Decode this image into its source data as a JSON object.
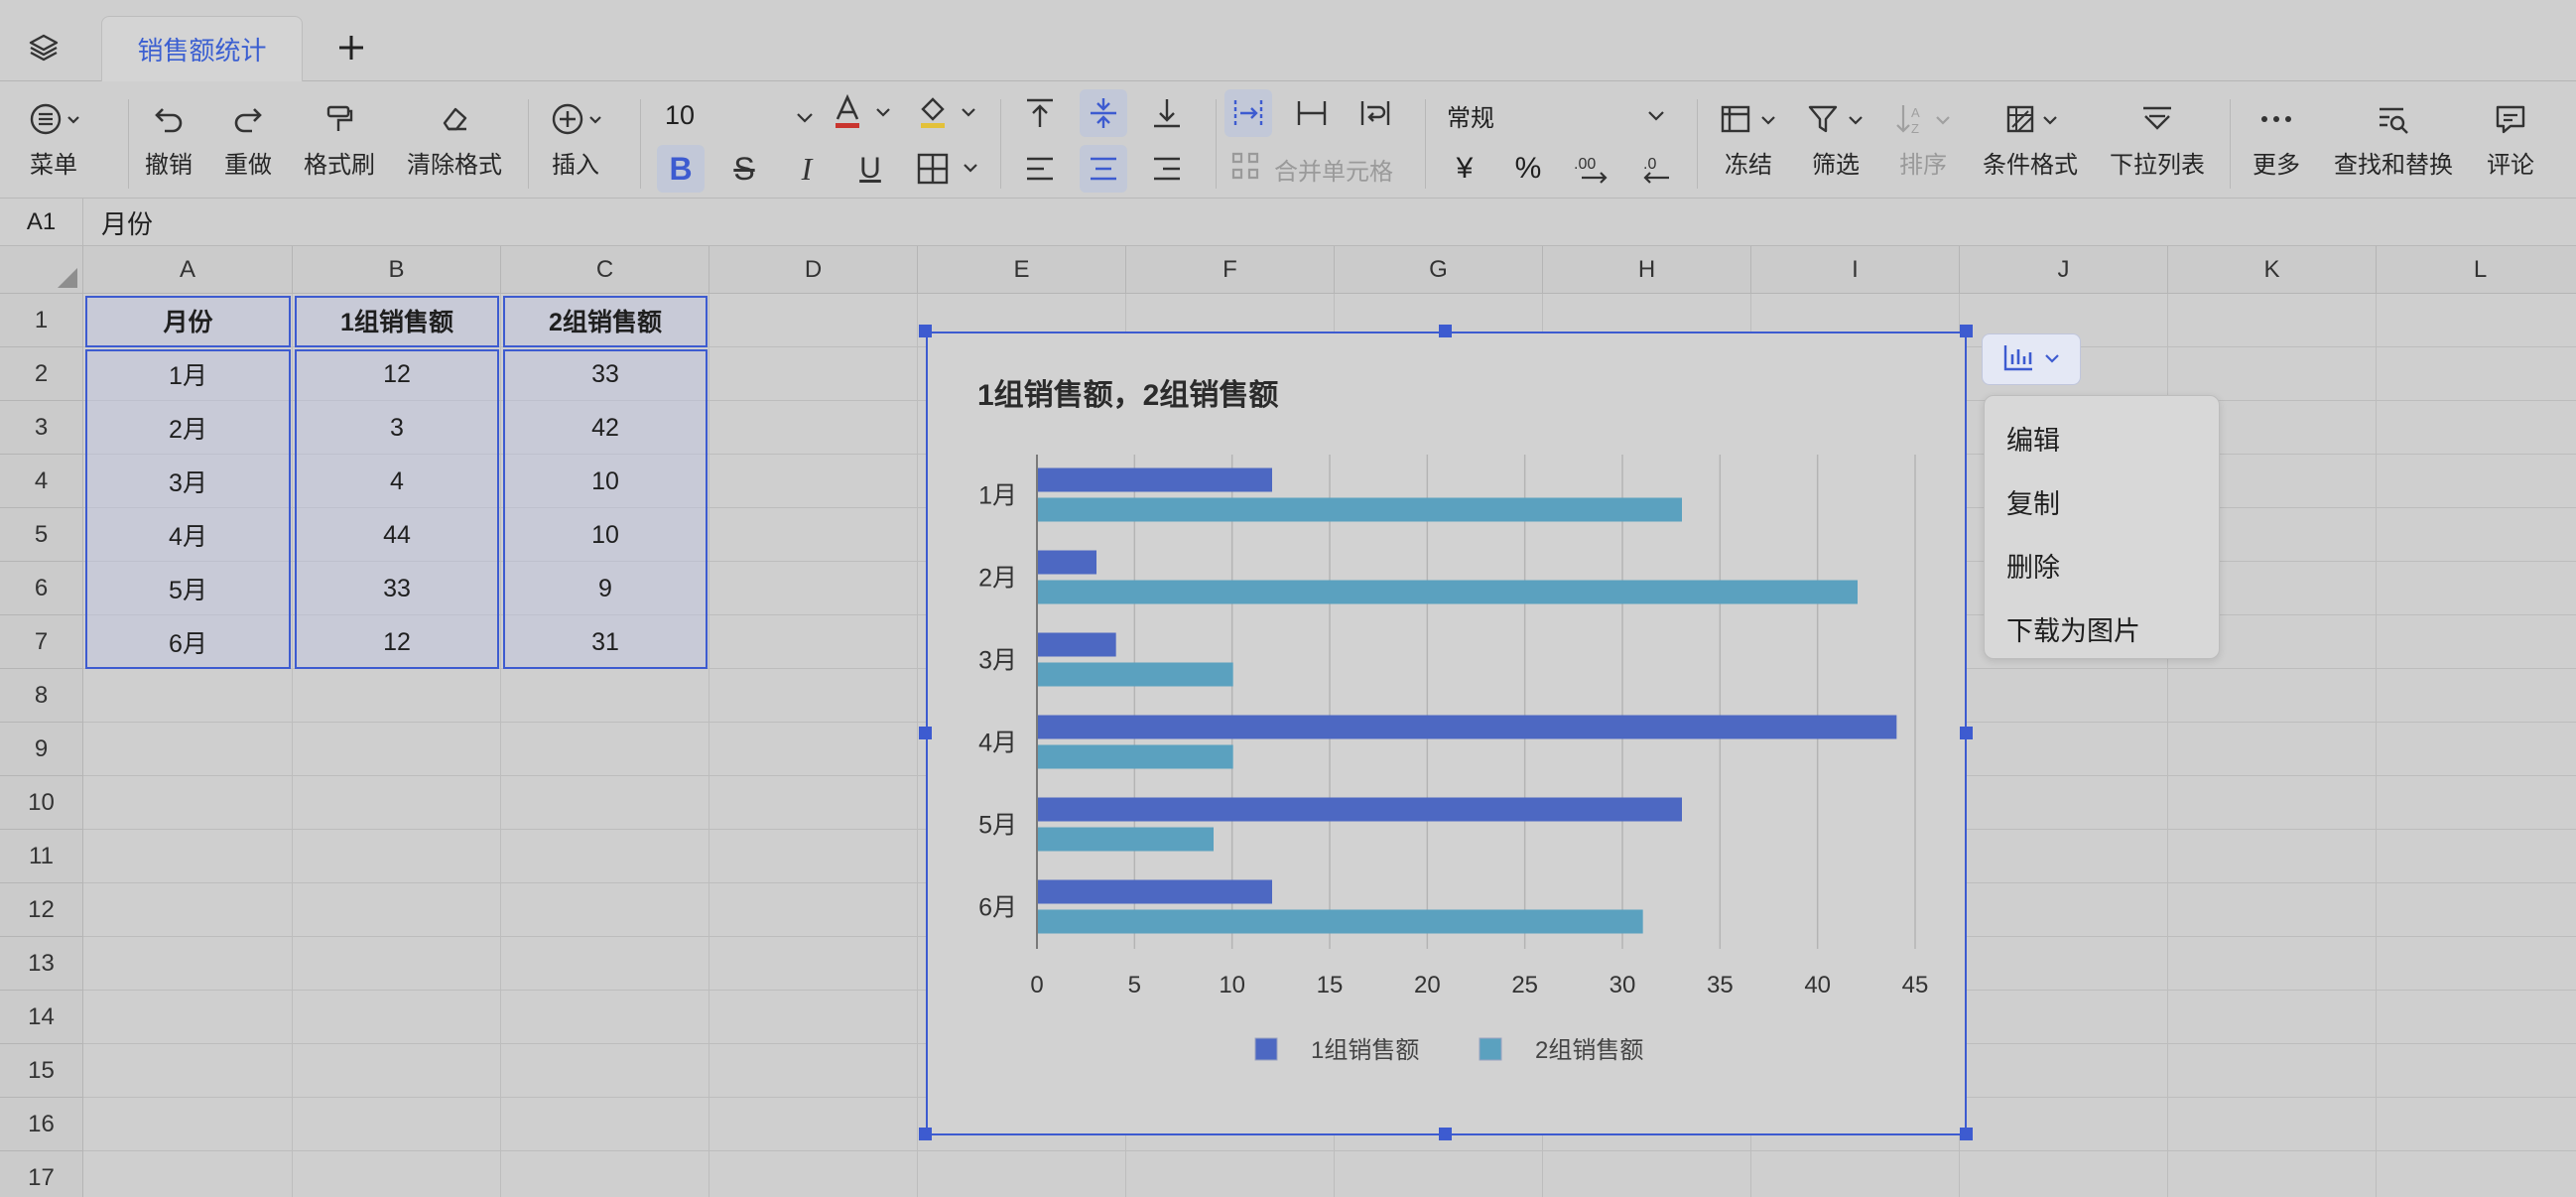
{
  "tabbar": {
    "sheet_tab": "销售额统计"
  },
  "toolbar": {
    "menu": "菜单",
    "undo": "撤销",
    "redo": "重做",
    "format_painter": "格式刷",
    "clear_format": "清除格式",
    "insert": "插入",
    "font_size": "10",
    "merge_cells": "合并单元格",
    "number_format": "常规",
    "currency": "¥",
    "percent": "%",
    "freeze": "冻结",
    "filter": "筛选",
    "sort": "排序",
    "conditional_format": "条件格式",
    "dropdown_list": "下拉列表",
    "more": "更多",
    "find_replace": "查找和替换",
    "comment": "评论"
  },
  "formula_bar": {
    "cell_ref": "A1",
    "value": "月份"
  },
  "columns": [
    "A",
    "B",
    "C",
    "D",
    "E",
    "F",
    "G",
    "H",
    "I",
    "J",
    "K",
    "L"
  ],
  "rows": [
    "1",
    "2",
    "3",
    "4",
    "5",
    "6",
    "7",
    "8",
    "9",
    "10",
    "11",
    "12",
    "13",
    "14",
    "15",
    "16",
    "17"
  ],
  "table": {
    "headers": [
      "月份",
      "1组销售额",
      "2组销售额"
    ],
    "rows": [
      [
        "1月",
        "12",
        "33"
      ],
      [
        "2月",
        "3",
        "42"
      ],
      [
        "3月",
        "4",
        "10"
      ],
      [
        "4月",
        "44",
        "10"
      ],
      [
        "5月",
        "33",
        "9"
      ],
      [
        "6月",
        "12",
        "31"
      ]
    ]
  },
  "chart_data": {
    "type": "bar",
    "orientation": "horizontal",
    "title": "1组销售额，2组销售额",
    "categories": [
      "1月",
      "2月",
      "3月",
      "4月",
      "5月",
      "6月"
    ],
    "series": [
      {
        "name": "1组销售额",
        "values": [
          12,
          3,
          4,
          44,
          33,
          12
        ],
        "color": "#4d68c2"
      },
      {
        "name": "2组销售额",
        "values": [
          33,
          42,
          10,
          10,
          9,
          31
        ],
        "color": "#5ba1bf"
      }
    ],
    "xlim": [
      0,
      45
    ],
    "xticks": [
      "0",
      "5",
      "10",
      "15",
      "20",
      "25",
      "30",
      "35",
      "40",
      "45"
    ],
    "grid": true,
    "legend": "bottom"
  },
  "context_menu": {
    "items": [
      "编辑",
      "复制",
      "删除",
      "下载为图片"
    ]
  },
  "colors": {
    "accent": "#3d5bd0",
    "tab_text": "#3b5fd1"
  }
}
